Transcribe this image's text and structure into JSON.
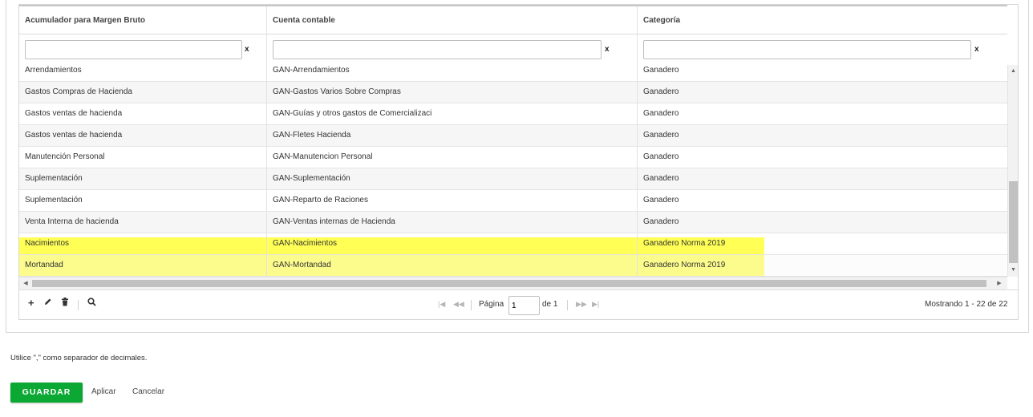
{
  "columns": [
    {
      "label": "Acumulador para Margen Bruto"
    },
    {
      "label": "Cuenta contable"
    },
    {
      "label": "Categoría"
    }
  ],
  "filters": [
    {
      "value": "",
      "clear": "x"
    },
    {
      "value": "",
      "clear": "x"
    },
    {
      "value": "",
      "clear": "x"
    }
  ],
  "rows": [
    {
      "acumulador": "Arrendamientos",
      "cuenta": "GAN-Arrendamientos",
      "categoria": "Ganadero",
      "highlighted": false
    },
    {
      "acumulador": "Gastos Compras de Hacienda",
      "cuenta": "GAN-Gastos Varios Sobre Compras",
      "categoria": "Ganadero",
      "highlighted": false
    },
    {
      "acumulador": "Gastos ventas de hacienda",
      "cuenta": "GAN-Guías y otros gastos de Comercializaci",
      "categoria": "Ganadero",
      "highlighted": false
    },
    {
      "acumulador": "Gastos ventas de hacienda",
      "cuenta": "GAN-Fletes Hacienda",
      "categoria": "Ganadero",
      "highlighted": false
    },
    {
      "acumulador": "Manutención Personal",
      "cuenta": "GAN-Manutencion Personal",
      "categoria": "Ganadero",
      "highlighted": false
    },
    {
      "acumulador": "Suplementación",
      "cuenta": "GAN-Suplementación",
      "categoria": "Ganadero",
      "highlighted": false
    },
    {
      "acumulador": "Suplementación",
      "cuenta": "GAN-Reparto de Raciones",
      "categoria": "Ganadero",
      "highlighted": false
    },
    {
      "acumulador": "Venta Interna de hacienda",
      "cuenta": "GAN-Ventas internas de Hacienda",
      "categoria": "Ganadero",
      "highlighted": false
    },
    {
      "acumulador": "Nacimientos",
      "cuenta": "GAN-Nacimientos",
      "categoria": "Ganadero Norma 2019",
      "highlighted": true
    },
    {
      "acumulador": "Mortandad",
      "cuenta": "GAN-Mortandad",
      "categoria": "Ganadero Norma 2019",
      "highlighted": true
    }
  ],
  "colors": {
    "highlight": "#ffff55",
    "save_button": "#0ca834"
  },
  "pager": {
    "page_label": "Página",
    "page_value": "1",
    "of_label": "de 1",
    "status": "Mostrando 1 - 22 de 22",
    "icons": [
      "plus-icon",
      "pencil-icon",
      "trash-icon",
      "search-icon",
      "first-page-icon",
      "prev-page-icon",
      "next-page-icon",
      "last-page-icon"
    ]
  },
  "note": "Utilice \",\" como separador de decimales.",
  "actions": {
    "save": "GUARDAR",
    "apply": "Aplicar",
    "cancel": "Cancelar"
  }
}
